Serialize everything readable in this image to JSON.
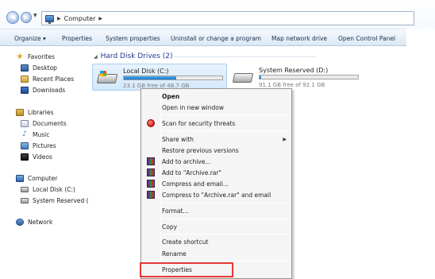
{
  "address": {
    "crumbs": [
      "Computer"
    ]
  },
  "toolbar": {
    "organize": "Organize",
    "properties": "Properties",
    "system_properties": "System properties",
    "uninstall": "Uninstall or change a program",
    "map_drive": "Map network drive",
    "control_panel": "Open Control Panel"
  },
  "sidebar": {
    "favorites": "Favorites",
    "desktop": "Desktop",
    "recent": "Recent Places",
    "downloads": "Downloads",
    "libraries": "Libraries",
    "documents": "Documents",
    "music": "Music",
    "pictures": "Pictures",
    "videos": "Videos",
    "computer": "Computer",
    "local_disk": "Local Disk (C:)",
    "system_reserved": "System Reserved (D:",
    "network": "Network"
  },
  "content": {
    "group_title": "Hard Disk Drives (2)",
    "drives": [
      {
        "name": "Local Disk (C:)",
        "free": "23.1 GB free of 48.7 GB",
        "used_fraction": 0.53
      },
      {
        "name": "System Reserved (D:)",
        "free": "91.1 GB free of 92.1 GB",
        "used_fraction": 0.02
      }
    ]
  },
  "context_menu": {
    "open": "Open",
    "open_new_window": "Open in new window",
    "scan": "Scan for security threats",
    "share_with": "Share with",
    "restore": "Restore previous versions",
    "add_archive": "Add to archive...",
    "add_rar": "Add to \"Archive.rar\"",
    "compress_email": "Compress and email...",
    "compress_rar_email": "Compress to \"Archive.rar\" and email",
    "format": "Format...",
    "copy": "Copy",
    "create_shortcut": "Create shortcut",
    "rename": "Rename",
    "properties": "Properties"
  },
  "colors": {
    "highlight_border": "#e53935",
    "accent": "#1e3a8a",
    "bar_fill": "#1b75c9"
  },
  "icons": [
    "back-arrow-icon",
    "forward-arrow-icon",
    "computer-icon",
    "star-icon",
    "hard-drive-icon",
    "security-shield-icon",
    "winrar-icon",
    "submenu-arrow-icon"
  ]
}
